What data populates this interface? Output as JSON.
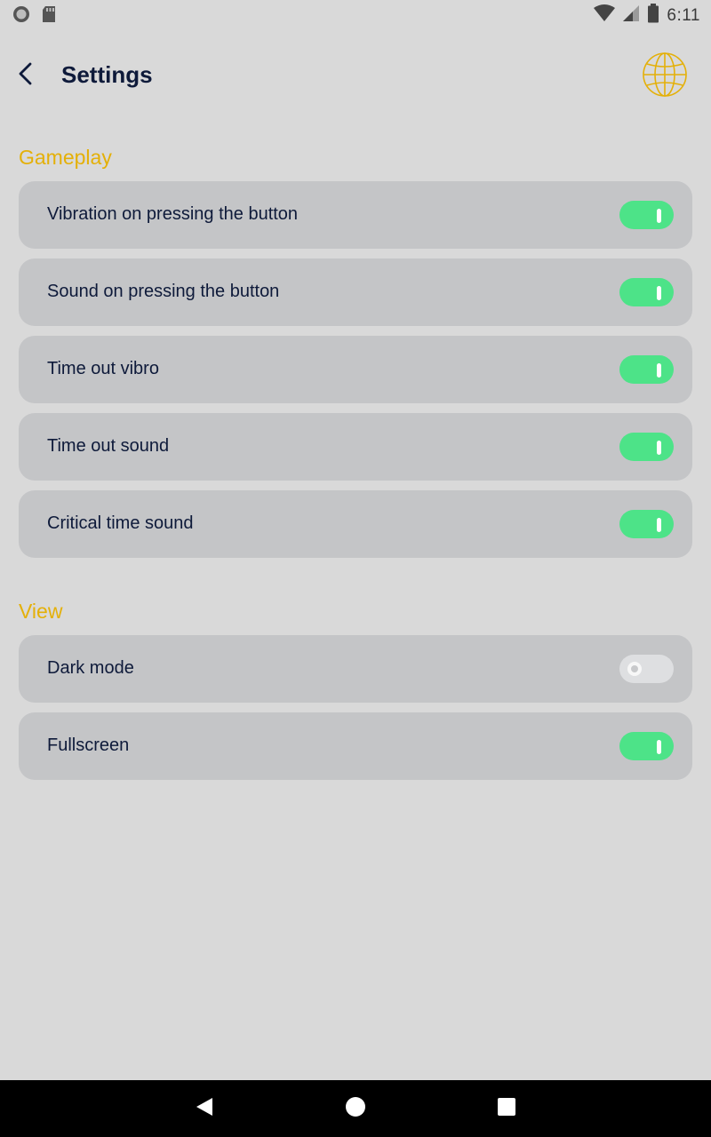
{
  "status_bar": {
    "time": "6:11",
    "icons": [
      "circle-app-icon",
      "sd-card-icon",
      "wifi-icon",
      "signal-icon",
      "battery-icon"
    ]
  },
  "header": {
    "title": "Settings",
    "back_icon": "back-arrow-icon",
    "language_icon": "globe-icon"
  },
  "sections": [
    {
      "title": "Gameplay",
      "items": [
        {
          "label": "Vibration on pressing the button",
          "enabled": true
        },
        {
          "label": "Sound on pressing the button",
          "enabled": true
        },
        {
          "label": "Time out vibro",
          "enabled": true
        },
        {
          "label": "Time out sound",
          "enabled": true
        },
        {
          "label": "Critical time sound",
          "enabled": true
        }
      ]
    },
    {
      "title": "View",
      "items": [
        {
          "label": "Dark mode",
          "enabled": false
        },
        {
          "label": "Fullscreen",
          "enabled": true
        }
      ]
    }
  ],
  "nav_bar": {
    "icons": [
      "nav-back-icon",
      "nav-home-icon",
      "nav-recents-icon"
    ]
  },
  "colors": {
    "background": "#d9d9d9",
    "card": "#c4c5c7",
    "accent": "#e4b008",
    "toggle_on": "#4de388",
    "toggle_off": "#dedfe1",
    "text": "#0e1a3a"
  }
}
